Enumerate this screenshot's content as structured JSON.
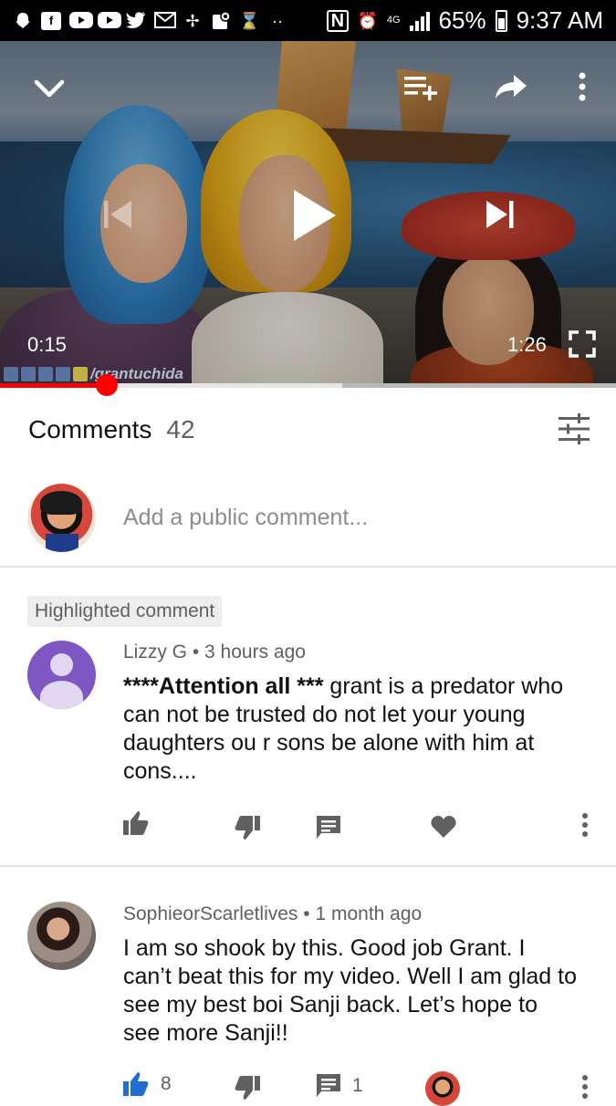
{
  "status_bar": {
    "battery": "65%",
    "time": "9:37 AM",
    "network_label": "4G",
    "icons": [
      "snapchat-icon",
      "facebook-icon",
      "youtube-icon",
      "youtube-icon",
      "twitter-icon",
      "gmail-icon",
      "pinwheel-icon",
      "maps-icon",
      "hourglass-icon",
      "more-dots-icon",
      "nfc-icon",
      "alarm-icon",
      "data-icon",
      "signal-icon",
      "battery-icon"
    ]
  },
  "player": {
    "current_time": "0:15",
    "duration": "1:26",
    "progress_fraction": 0.174,
    "buffer_fraction": 0.555,
    "watermark": "/grantuchida",
    "icons": {
      "collapse": "chevron-down-icon",
      "add_to_playlist": "playlist-add-icon",
      "share": "share-icon",
      "more": "more-vert-icon",
      "previous": "skip-previous-icon",
      "play": "play-icon",
      "next": "skip-next-icon",
      "fullscreen": "fullscreen-icon"
    }
  },
  "comments": {
    "title": "Comments",
    "count": "42",
    "add_placeholder": "Add a public comment...",
    "highlighted_badge": "Highlighted comment",
    "items": [
      {
        "author": "Lizzy G",
        "time": "3 hours ago",
        "text_bold": "****Attention all ***",
        "text": " grant is a predator who can not be trusted do not let your young daughters ou r sons be alone with him at cons....",
        "likes": "",
        "replies": ""
      },
      {
        "author": "SophieorScarletlives",
        "time": "1 month ago",
        "text_bold": "",
        "text": "I am so shook by this. Good job Grant. I can’t beat this for my video. Well I am glad to see my best boi Sanji back. Let’s hope to see more Sanji!!",
        "likes": "8",
        "replies": "1"
      }
    ]
  },
  "colors": {
    "accent_red": "#ff0000",
    "like_active_blue": "#1e6fd1",
    "avatar_purple": "#7f57c2"
  }
}
